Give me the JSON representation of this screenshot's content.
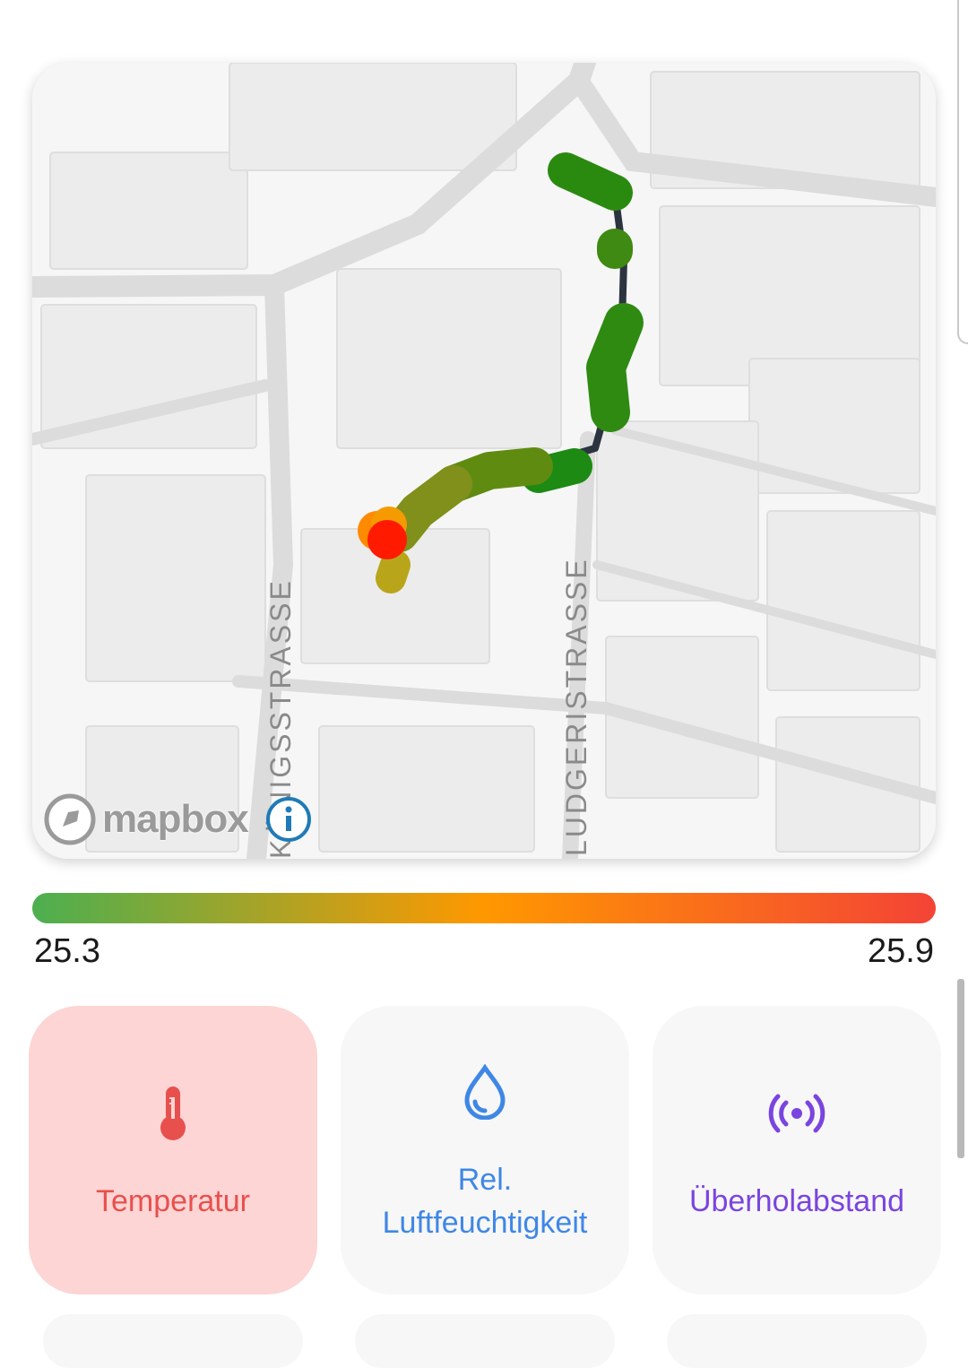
{
  "map": {
    "attribution": "mapbox",
    "streets": [
      "KÖNIGSSTRASSE",
      "LUDGERISTRASSE"
    ]
  },
  "legend": {
    "min": "25.3",
    "max": "25.9",
    "colors": [
      "#4caf50",
      "#ff9800",
      "#f44336"
    ]
  },
  "tiles": [
    {
      "label": "Temperatur",
      "icon": "thermometer-icon",
      "color": "#e8504d",
      "active": true
    },
    {
      "label": "Rel.\nLuftfeuchtigkeit",
      "icon": "water-drop-icon",
      "color": "#3f87e6",
      "active": false
    },
    {
      "label": "Überholabstand",
      "icon": "broadcast-sensor-icon",
      "color": "#7a44e0",
      "active": false
    }
  ]
}
